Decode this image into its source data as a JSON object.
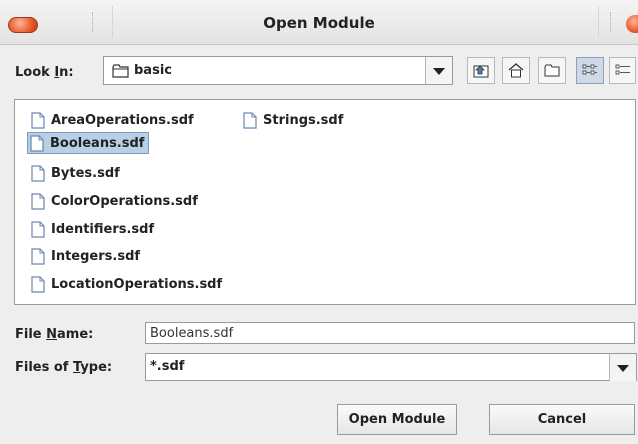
{
  "window": {
    "title": "Open Module"
  },
  "lookin": {
    "label_pre": "Look ",
    "label_mn": "I",
    "label_post": "n:",
    "value": "basic"
  },
  "toolbar": {
    "icons": [
      "up-folder-icon",
      "home-icon",
      "new-folder-icon",
      "list-view-icon",
      "details-view-icon"
    ]
  },
  "files": {
    "items": [
      {
        "name": "AreaOperations.sdf"
      },
      {
        "name": "Booleans.sdf",
        "selected": true
      },
      {
        "name": "Bytes.sdf"
      },
      {
        "name": "ColorOperations.sdf"
      },
      {
        "name": "Identifiers.sdf"
      },
      {
        "name": "Integers.sdf"
      },
      {
        "name": "LocationOperations.sdf"
      },
      {
        "name": "Strings.sdf"
      }
    ]
  },
  "filename": {
    "label_pre": "File ",
    "label_mn": "N",
    "label_post": "ame:",
    "value": "Booleans.sdf"
  },
  "filetype": {
    "label_pre": "Files of ",
    "label_mn": "T",
    "label_post": "ype:",
    "value": "*.sdf"
  },
  "buttons": {
    "open": "Open Module",
    "cancel": "Cancel"
  }
}
